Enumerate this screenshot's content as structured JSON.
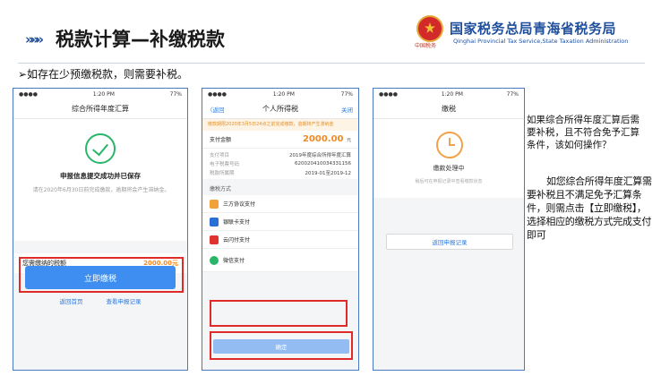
{
  "header": {
    "chevrons": "»»»",
    "title": "税款计算—补缴税款",
    "emblem_caption": "中国税务",
    "bureau_cn": "国家税务总局青海省税务局",
    "bureau_en": "Qinghai Provincial Tax Service,State Taxation Administration"
  },
  "intro": "➢如存在少预缴税款，则需要补税。",
  "phone1": {
    "status_time": "1:20 PM",
    "status_battery": "77%",
    "nav_title": "综合所得年度汇算",
    "title": "申报信息提交成功并已保存",
    "hint": "请在2020年6月30日前完成缴款，逾期将会产生滞纳金。",
    "amount_label": "您需缴纳的税额",
    "amount_value": "2000.00元",
    "pay_button": "立即缴税",
    "link_home": "返回首页",
    "link_records": "查看申报记录"
  },
  "phone2": {
    "status_time": "1:20 PM",
    "status_battery": "77%",
    "nav_back": "〈返回",
    "nav_title": "个人所得税",
    "nav_right": "关闭",
    "notice": "缴款期限2020年3月5日24点之前完成缴款，逾期将产生滞纳金",
    "amount_label": "支付金额",
    "amount_value": "2000.00",
    "amount_unit": "元",
    "info": [
      {
        "k": "支付项目",
        "v": "2019年度综合所得年度汇算"
      },
      {
        "k": "电子税票号码",
        "v": "620020410034331156"
      },
      {
        "k": "税款所属期",
        "v": "2019-01至2019-12"
      }
    ],
    "section_title": "缴税方式",
    "methods": [
      "三方协议支付",
      "银联卡支付",
      "云闪付支付",
      "微信支付"
    ],
    "confirm": "确定"
  },
  "phone3": {
    "status_time": "1:20 PM",
    "status_battery": "77%",
    "nav_title": "缴税",
    "title": "缴款处理中",
    "hint": "稍后可在申报记录中查看缴款状态",
    "back_button": "返回申报记录"
  },
  "side": {
    "question": "如果综合所得年度汇算后需要补税，且不符合免予汇算条件，该如何操作？",
    "answer": "如您综合所得年度汇算需要补税且不满足免予汇算条件，则需点击【立即缴税】，选择相应的缴税方式完成支付即可"
  },
  "colors": {
    "accent_blue": "#1f4e9c",
    "button_blue": "#3d8ef0",
    "highlight_red": "#e02a2a",
    "amount_orange": "#f08a24",
    "success_green": "#2ab66a"
  }
}
